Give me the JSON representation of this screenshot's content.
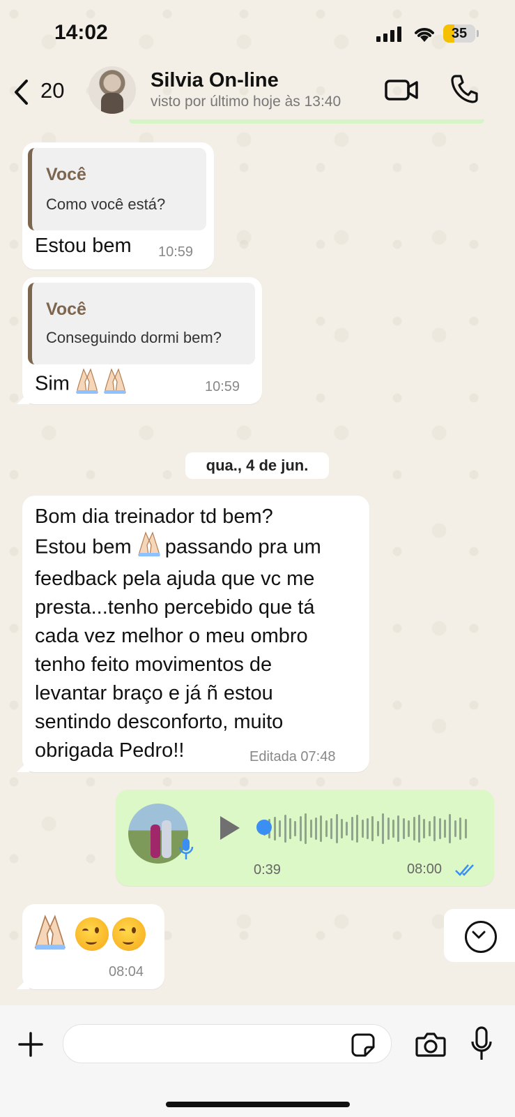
{
  "status_bar": {
    "time": "14:02",
    "battery": "35",
    "battery_level_percent": 35
  },
  "header": {
    "back_count": "20",
    "contact_name": "Silvia On-line",
    "contact_status": "visto por último hoje às 13:40"
  },
  "messages": [
    {
      "quote_author": "Você",
      "quote_text": "Como você está?",
      "text": "Estou bem",
      "time": "10:59"
    },
    {
      "quote_author": "Você",
      "quote_text": "Conseguindo dormi bem?",
      "text": "Sim",
      "time": "10:59"
    }
  ],
  "date_separator": "qua., 4 de jun.",
  "long_message": {
    "lines": [
      "Bom dia treinador td bem?",
      "Estou bem",
      "passando pra um",
      "feedback pela ajuda que vc me",
      "presta...tenho percebido que tá",
      "cada vez melhor o meu ombro",
      "tenho feito movimentos de",
      "levantar braço e já ñ estou",
      "sentindo desconforto, muito",
      "obrigada Pedro!!"
    ],
    "time": "Editada 07:48"
  },
  "voice_message": {
    "duration": "0:39",
    "time": "08:00",
    "status": "read"
  },
  "emoji_message": {
    "time": "08:04"
  },
  "icons": [
    "back-icon",
    "video-icon",
    "phone-icon",
    "play-icon",
    "microphone-icon",
    "double-check-icon",
    "chevron-down-icon",
    "plus-icon",
    "sticker-icon",
    "camera-icon"
  ],
  "colors": {
    "outgoing_bubble": "#dcf8c6",
    "incoming_bubble": "#ffffff",
    "quote_accent": "#7d6650",
    "read_ticks": "#3b8ff3"
  }
}
